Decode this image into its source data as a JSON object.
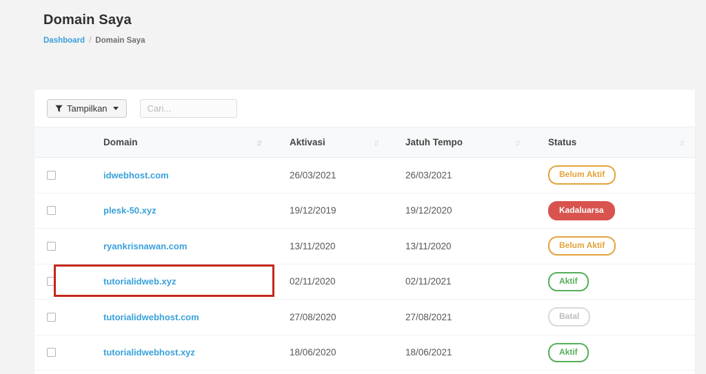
{
  "page": {
    "title": "Domain Saya",
    "breadcrumb": {
      "link": "Dashboard",
      "separator": "/",
      "current": "Domain Saya"
    }
  },
  "toolbar": {
    "filter_button_label": "Tampilkan",
    "search_placeholder": "Cari..."
  },
  "icons": {
    "sort": "↓↑",
    "filter": "funnel-icon",
    "caret": "caret-down-icon"
  },
  "table": {
    "columns": [
      "Domain",
      "Aktivasi",
      "Jatuh Tempo",
      "Status"
    ],
    "rows": [
      {
        "domain": "idwebhost.com",
        "aktivasi": "26/03/2021",
        "jatuh_tempo": "26/03/2021",
        "status": "Belum Aktif",
        "status_type": "belum-aktif",
        "checked": false
      },
      {
        "domain": "plesk-50.xyz",
        "aktivasi": "19/12/2019",
        "jatuh_tempo": "19/12/2020",
        "status": "Kadaluarsa",
        "status_type": "kadaluarsa",
        "checked": false
      },
      {
        "domain": "ryankrisnawan.com",
        "aktivasi": "13/11/2020",
        "jatuh_tempo": "13/11/2020",
        "status": "Belum Aktif",
        "status_type": "belum-aktif",
        "checked": false
      },
      {
        "domain": "tutorialidweb.xyz",
        "aktivasi": "02/11/2020",
        "jatuh_tempo": "02/11/2021",
        "status": "Aktif",
        "status_type": "aktif",
        "checked": false
      },
      {
        "domain": "tutorialidwebhost.com",
        "aktivasi": "27/08/2020",
        "jatuh_tempo": "27/08/2021",
        "status": "Batal",
        "status_type": "batal",
        "checked": false
      },
      {
        "domain": "tutorialidwebhost.xyz",
        "aktivasi": "18/06/2020",
        "jatuh_tempo": "18/06/2021",
        "status": "Aktif",
        "status_type": "aktif",
        "checked": false
      }
    ]
  },
  "status_colors": {
    "belum_aktif": "#e2a33b",
    "kadaluarsa": "#d9534f",
    "aktif": "#53ae58",
    "batal": "#bdbdbd"
  },
  "annotation": {
    "color": "#c3261b",
    "highlighted_domain": "tutorialidweb.xyz"
  }
}
